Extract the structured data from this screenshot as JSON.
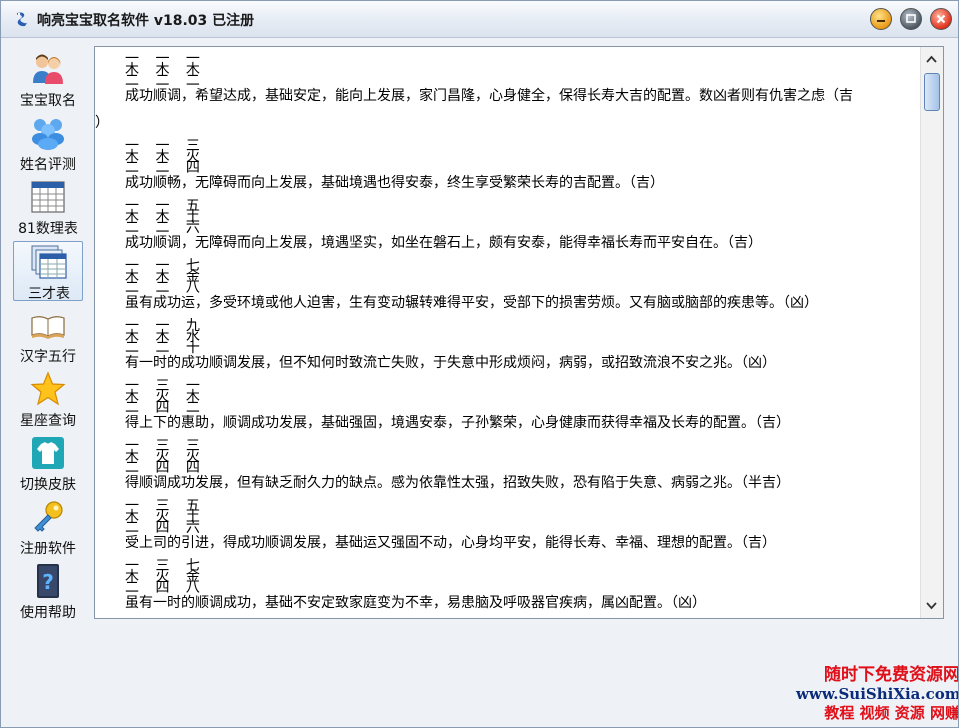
{
  "window": {
    "title": "响亮宝宝取名软件 v18.03  已注册"
  },
  "sidebar": {
    "items": [
      {
        "label": "宝宝取名",
        "icon": "people-icon"
      },
      {
        "label": "姓名评测",
        "icon": "users-icon"
      },
      {
        "label": "81数理表",
        "icon": "calendar-table-icon"
      },
      {
        "label": "三才表",
        "icon": "table-icon",
        "active": true
      },
      {
        "label": "汉字五行",
        "icon": "book-icon"
      },
      {
        "label": "星座查询",
        "icon": "star-icon"
      },
      {
        "label": "切换皮肤",
        "icon": "shirt-icon"
      },
      {
        "label": "注册软件",
        "icon": "key-icon"
      },
      {
        "label": "使用帮助",
        "icon": "help-book-icon"
      }
    ]
  },
  "content": {
    "lines": [
      {
        "kind": "tri",
        "text": "一 一 一"
      },
      {
        "kind": "tri",
        "text": "木 木 木"
      },
      {
        "kind": "tri",
        "text": "二 二 二"
      },
      {
        "kind": "desc",
        "text": "成功顺调，希望达成，基础安定，能向上发展，家门昌隆，心身健全，保得长寿大吉的配置。数凶者则有仇害之虑（吉"
      },
      {
        "kind": "desc",
        "text": "）"
      },
      {
        "kind": "tri",
        "text": "一 一 三"
      },
      {
        "kind": "tri",
        "text": "木 木 火"
      },
      {
        "kind": "tri",
        "text": "二 二 四"
      },
      {
        "kind": "desc",
        "text": "成功顺畅，无障碍而向上发展，基础境遇也得安泰，终生享受繁荣长寿的吉配置。（吉）"
      },
      {
        "kind": "tri",
        "text": "一 一 五"
      },
      {
        "kind": "tri",
        "text": "木 木 土"
      },
      {
        "kind": "tri",
        "text": "二 二 六"
      },
      {
        "kind": "desc",
        "text": "成功顺调，无障碍而向上发展，境遇坚实，如坐在磐石上，颇有安泰，能得幸福长寿而平安自在。（吉）"
      },
      {
        "kind": "tri",
        "text": "一 一 七"
      },
      {
        "kind": "tri",
        "text": "木 木 金"
      },
      {
        "kind": "tri",
        "text": "二 二 八"
      },
      {
        "kind": "desc",
        "text": "虽有成功运，多受环境或他人迫害，生有变动辗转难得平安，受部下的损害劳烦。又有脑或脑部的疾患等。（凶）"
      },
      {
        "kind": "tri",
        "text": "一 一 九"
      },
      {
        "kind": "tri",
        "text": "木 木 水"
      },
      {
        "kind": "tri",
        "text": "二 二 十"
      },
      {
        "kind": "desc",
        "text": "有一时的成功顺调发展，但不知何时致流亡失败，于失意中形成烦闷，病弱，或招致流浪不安之兆。（凶）"
      },
      {
        "kind": "tri",
        "text": "一 三 一"
      },
      {
        "kind": "tri",
        "text": "木 火 木"
      },
      {
        "kind": "tri",
        "text": "二 四 二"
      },
      {
        "kind": "desc",
        "text": "得上下的惠助，顺调成功发展，基础强固，境遇安泰，子孙繁荣，心身健康而获得幸福及长寿的配置。（吉）"
      },
      {
        "kind": "tri",
        "text": "一 三 三"
      },
      {
        "kind": "tri",
        "text": "木 火 火"
      },
      {
        "kind": "tri",
        "text": "二 四 四"
      },
      {
        "kind": "desc",
        "text": "得顺调成功发展，但有缺乏耐久力的缺点。感为依靠性太强，招致失败，恐有陷于失意、病弱之兆。（半吉）"
      },
      {
        "kind": "tri",
        "text": "一 三 五"
      },
      {
        "kind": "tri",
        "text": "木 火 土"
      },
      {
        "kind": "tri",
        "text": "二 四 六"
      },
      {
        "kind": "desc",
        "text": "受上司的引进，得成功顺调发展，基础运又强固不动，心身均平安，能得长寿、幸福、理想的配置。（吉）"
      },
      {
        "kind": "tri",
        "text": "一 三 七"
      },
      {
        "kind": "tri",
        "text": "木 火 金"
      },
      {
        "kind": "tri",
        "text": "二 四 八"
      },
      {
        "kind": "desc",
        "text": "虽有一时的顺调成功，基础不安定致家庭变为不幸，易患脑及呼吸器官疾病，属凶配置。（凶）"
      }
    ]
  },
  "watermark": {
    "line1": "随时下免费资源网",
    "line2": "www.SuiShiXia.com",
    "line3": "教程 视频 资源 网赚"
  }
}
